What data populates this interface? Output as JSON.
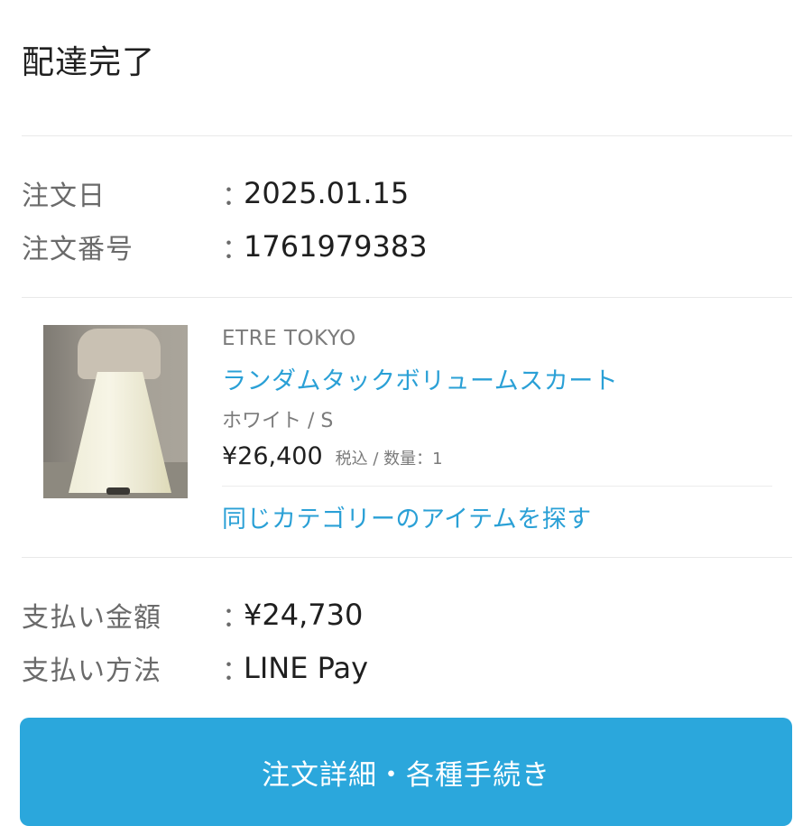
{
  "status": {
    "title": "配達完了"
  },
  "order": {
    "date_label": "注文日",
    "date_value": "2025.01.15",
    "number_label": "注文番号",
    "number_value": "1761979383"
  },
  "item": {
    "image_icon": "product-photo",
    "brand": "ETRE TOKYO",
    "name": "ランダムタックボリュームスカート",
    "variant": "ホワイト / S",
    "price": "¥26,400",
    "price_note": "税込 / 数量：1",
    "similar_link": "同じカテゴリーのアイテムを探す"
  },
  "payment": {
    "amount_label": "支払い金額",
    "amount_value": "¥24,730",
    "method_label": "支払い方法",
    "method_value": "LINE Pay"
  },
  "colon": "：",
  "button": {
    "label": "注文詳細・各種手続き"
  },
  "colors": {
    "accent": "#2ba7dc",
    "link": "#2aa0d6"
  }
}
